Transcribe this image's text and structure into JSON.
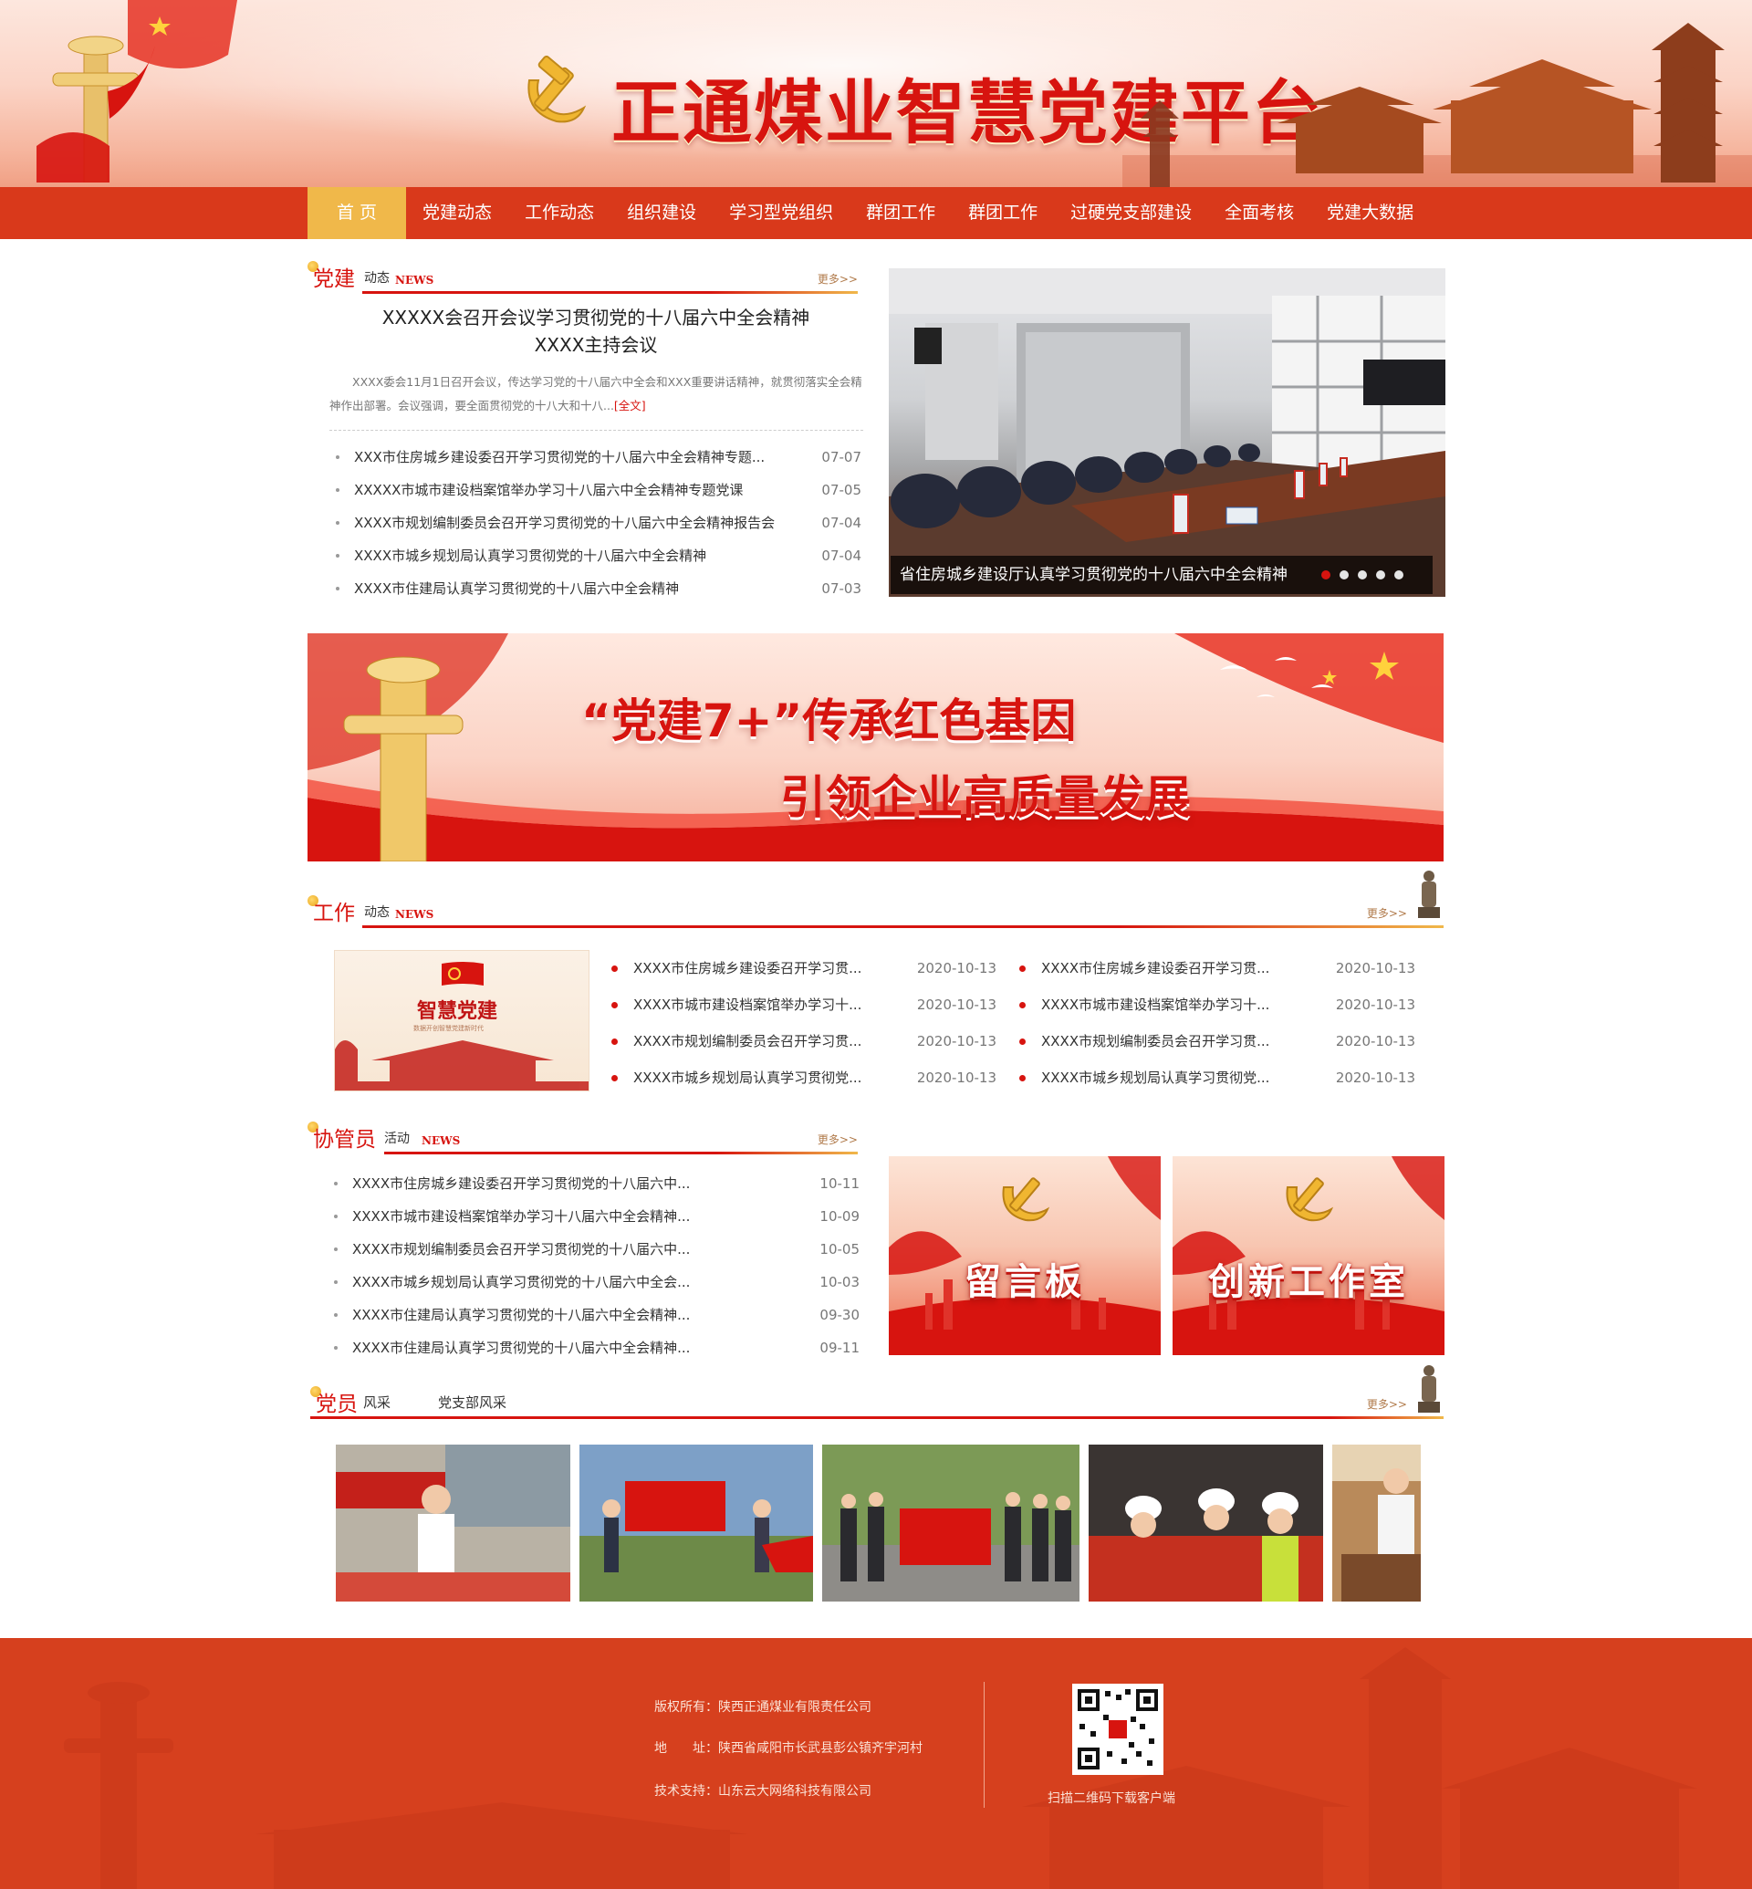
{
  "header": {
    "title": "正通煤业智慧党建平台"
  },
  "nav": {
    "items": [
      "首 页",
      "党建动态",
      "工作动态",
      "组织建设",
      "学习型党组织",
      "群团工作",
      "群团工作",
      "过硬党支部建设",
      "全面考核",
      "党建大数据"
    ],
    "active_index": 0
  },
  "party_news": {
    "heading_big": "党建",
    "heading_small": "动态",
    "heading_news": "NEWS",
    "more": "更多>>",
    "feature": {
      "title_line1": "XXXXX会召开会议学习贯彻党的十八届六中全会精神",
      "title_line2": "XXXX主持会议",
      "desc": "XXXX委会11月1日召开会议，传达学习党的十八届六中全会和XXX重要讲话精神，就贯彻落实全会精神作出部署。会议强调，要全面贯彻党的十八大和十八...",
      "full_link": "[全文]"
    },
    "items": [
      {
        "title": "XXX市住房城乡建设委召开学习贯彻党的十八届六中全会精神专题...",
        "date": "07-07"
      },
      {
        "title": "XXXXX市城市建设档案馆举办学习十八届六中全会精神专题党课",
        "date": "07-05"
      },
      {
        "title": "XXXX市规划编制委员会召开学习贯彻党的十八届六中全会精神报告会",
        "date": "07-04"
      },
      {
        "title": "XXXX市城乡规划局认真学习贯彻党的十八届六中全会精神",
        "date": "07-04"
      },
      {
        "title": "XXXX市住建局认真学习贯彻党的十八届六中全会精神",
        "date": "07-03"
      }
    ]
  },
  "slideshow": {
    "caption": "省住房城乡建设厅认真学习贯彻党的十八届六中全会精神",
    "dot_count": 5,
    "active_dot": 0
  },
  "banner": {
    "line1": "“党建7+”传承红色基因",
    "line2": "引领企业高质量发展"
  },
  "work_news": {
    "heading_big": "工作",
    "heading_small": "动态",
    "heading_news": "NEWS",
    "more": "更多>>",
    "thumb_title": "智慧党建",
    "thumb_sub": "数据开创智慧党建新时代",
    "col1": [
      {
        "title": "XXXX市住房城乡建设委召开学习贯...",
        "date": "2020-10-13"
      },
      {
        "title": "XXXX市城市建设档案馆举办学习十...",
        "date": "2020-10-13"
      },
      {
        "title": "XXXX市规划编制委员会召开学习贯...",
        "date": "2020-10-13"
      },
      {
        "title": "XXXX市城乡规划局认真学习贯彻党...",
        "date": "2020-10-13"
      }
    ],
    "col2": [
      {
        "title": "XXXX市住房城乡建设委召开学习贯...",
        "date": "2020-10-13"
      },
      {
        "title": "XXXX市城市建设档案馆举办学习十...",
        "date": "2020-10-13"
      },
      {
        "title": "XXXX市规划编制委员会召开学习贯...",
        "date": "2020-10-13"
      },
      {
        "title": "XXXX市城乡规划局认真学习贯彻党...",
        "date": "2020-10-13"
      }
    ]
  },
  "coordinator": {
    "heading_big": "协管员",
    "heading_small": "活动",
    "heading_news": "NEWS",
    "more": "更多>>",
    "items": [
      {
        "title": "XXXX市住房城乡建设委召开学习贯彻党的十八届六中...",
        "date": "10-11"
      },
      {
        "title": "XXXX市城市建设档案馆举办学习十八届六中全会精神...",
        "date": "10-09"
      },
      {
        "title": "XXXX市规划编制委员会召开学习贯彻党的十八届六中...",
        "date": "10-05"
      },
      {
        "title": "XXXX市城乡规划局认真学习贯彻党的十八届六中全会...",
        "date": "10-03"
      },
      {
        "title": "XXXX市住建局认真学习贯彻党的十八届六中全会精神...",
        "date": "09-30"
      },
      {
        "title": "XXXX市住建局认真学习贯彻党的十八届六中全会精神...",
        "date": "09-11"
      }
    ],
    "tiles": [
      "留言板",
      "创新工作室"
    ]
  },
  "members": {
    "heading_big": "党员",
    "heading_small": "风采",
    "tab2": "党支部风采",
    "more": "更多>>"
  },
  "footer": {
    "copyright": "版权所有：陕西正通煤业有限责任公司",
    "address": "地　　址：陕西省咸阳市长武县彭公镇齐宇河村",
    "support": "技术支持：山东云大网络科技有限公司",
    "qr_text": "扫描二维码下载客户端"
  },
  "colors": {
    "primary_red": "#d7140f",
    "nav_red": "#d9391b",
    "nav_active": "#f0b84a",
    "footer_red": "#d6401e"
  }
}
